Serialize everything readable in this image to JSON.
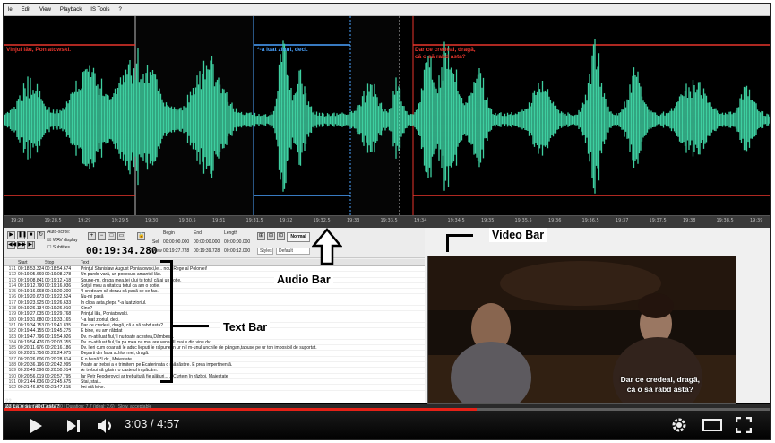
{
  "app": {
    "menu": [
      "le",
      "Edit",
      "View",
      "Playback",
      "IS Tools",
      "?"
    ]
  },
  "waveform": {
    "labels": [
      {
        "text": "Vinjul lău, Poniatowski.",
        "color": "red"
      },
      {
        "text": "*-a luat zioul, deci.",
        "color": "blue"
      },
      {
        "text": "Dar ce credeai, dragă,\ncă o să rabd asta?",
        "color": "red"
      }
    ],
    "wave_color": "#3ecfa0",
    "timeline_ticks": [
      "19:28",
      "19:28.5",
      "19:29",
      "19:29.5",
      "19:30",
      "19:30.5",
      "19:31",
      "19:31.5",
      "19:32",
      "19:32.5",
      "19:33",
      "19:33.5",
      "19:34",
      "19:34.5",
      "19:35",
      "19:35.5",
      "19:36",
      "19:36.5",
      "19:37",
      "19:37.5",
      "19:38",
      "19:38.5",
      "19:39"
    ]
  },
  "controls": {
    "auto_scroll": "Auto-scroll:",
    "wav_display": "WAV display",
    "subtitles": "Subtitles",
    "timecode": "00:19:34.280",
    "begin_label": "Begin",
    "end_label": "End",
    "length_label": "Length",
    "sel_label": "Sel",
    "view_label": "View",
    "sel_begin": "00:00:00.000",
    "sel_end": "00:00:00.000",
    "sel_length": "00:00:00.000",
    "view_begin": "00:19:27.728",
    "view_end": "00:19:39.728",
    "view_length": "00:00:12.000",
    "normal": "Normal",
    "styles": "Styles",
    "default": "Default"
  },
  "grid": {
    "headers": [
      "",
      "Start",
      "Stop",
      "Text"
    ],
    "rows": [
      {
        "num": "171",
        "start": "00:18:53.324",
        "stop": "00:18:54.674",
        "text": "Prinţul Stanislaw August Poniatowski,le... noul Rege al Poloniei!"
      },
      {
        "num": "172",
        "start": "00:19:05.669",
        "stop": "00:19:08.278",
        "text": "Un pardo-varã, un posesuls amantul lãu."
      },
      {
        "num": "173",
        "start": "00:19:08.841",
        "stop": "00:19:12.418",
        "text": "Spune-mi, draga mea,tei ului tu totul cã ai un sotie."
      },
      {
        "num": "174",
        "start": "00:19:12.790",
        "stop": "00:19:16.036",
        "text": "Sotjul meu a uitat cu totul ca am o sotie."
      },
      {
        "num": "175",
        "start": "00:19:16.968",
        "stop": "00:19:20.200",
        "text": "*I credeam cã doruu cã pasã ce ce fac."
      },
      {
        "num": "176",
        "start": "00:19:20.673",
        "stop": "00:19:22.524",
        "text": "Nu-mi pasã"
      },
      {
        "num": "177",
        "start": "00:19:23.925",
        "stop": "00:19:26.633",
        "text": "În clipa asta,plepa *-a luat zioriul."
      },
      {
        "num": "178",
        "start": "00:19:26.134",
        "stop": "00:19:26.910",
        "text": "Cine?"
      },
      {
        "num": "179",
        "start": "00:19:27.035",
        "stop": "00:19:29.768",
        "text": "Prinţul lãu, Poniatowski."
      },
      {
        "num": "180",
        "start": "00:19:31.680",
        "stop": "00:19:33.165",
        "text": "*-a luat zioriul, deci."
      },
      {
        "num": "181",
        "start": "00:19:34.153",
        "stop": "00:19:41.835",
        "text": "Dar ce credeai, dragã, cã o sã rabd asta?"
      },
      {
        "num": "182",
        "start": "00:19:44.155",
        "stop": "00:19:45.275",
        "text": "E bine, eu am rãbdat"
      },
      {
        "num": "183",
        "start": "00:19:47.796",
        "stop": "00:19:54.026",
        "text": "Dv. m-ati luat fiul,*I nu toate acestea,Dâmbesc."
      },
      {
        "num": "184",
        "start": "00:19:54.476",
        "stop": "00:20:03.355",
        "text": "Dv. m-ati luat fiul,*Ia pa mea nu mai are vena,*Il mai e din vine dv."
      },
      {
        "num": "185",
        "start": "00:20:11.676",
        "stop": "00:20:16.186",
        "text": "Dv. lieri cum doar ati le aduc lieputi le ralpune,in ur n-l m-unul unchile de pãngan,tapuse pe ur ton imposibil de suportat."
      },
      {
        "num": "186",
        "start": "00:20:21.756",
        "stop": "00:20:24.075",
        "text": "Departi din fapa schlor mei, dragã."
      },
      {
        "num": "187",
        "start": "00:20:26.606",
        "stop": "00:20:28.814",
        "text": "E o bunã *I dv., Maiestate."
      },
      {
        "num": "188",
        "start": "00:20:36.196",
        "stop": "00:20:42.995",
        "text": "Poate ar trebui a o trimitem pe Ecaterinata o mãnãstire. E prea impertinentã."
      },
      {
        "num": "189",
        "start": "00:20:49.596",
        "stop": "00:20:50.914",
        "text": "Ar trebui sã gãsim o castelul impãcãm."
      },
      {
        "num": "190",
        "start": "00:20:56.019",
        "stop": "00:20:57.795",
        "text": "Iar Petr Feodorovici ar trebuitutã fie alãturi... ...Curtem în rãzboi, Maiestate"
      },
      {
        "num": "191",
        "start": "00:21:44.636",
        "stop": "00:21:45.675",
        "text": "Stai, stai..."
      },
      {
        "num": "192",
        "start": "00:21:46.876",
        "stop": "00:21:47.515",
        "text": "Îmi stã bine."
      }
    ]
  },
  "video": {
    "subtitle": "Dar ce credeai, dragă,\ncă o să rabd asta?"
  },
  "annotations": {
    "text_bar": "Text Bar",
    "audio_bar": "Audio Bar",
    "video_bar": "Video Bar"
  },
  "status": {
    "prev_subtitle": "22 ...\n23 că o să rabd asta?",
    "status_line": "ne: 1, Column: 40, Chars: 50 | Duration: 7.7 (ideal: 2.6) | Slow, acceptable"
  },
  "player": {
    "current": "3:03",
    "separator": " / ",
    "total": "4:57",
    "progress": 0.616
  }
}
